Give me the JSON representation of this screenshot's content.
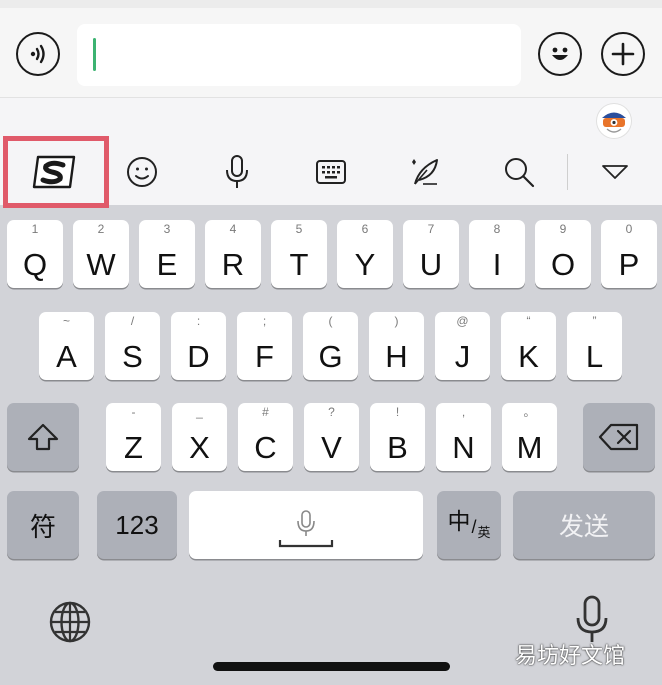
{
  "chat": {
    "voice_icon": "voice-wave-icon",
    "emoji_icon": "smiley-icon",
    "add_icon": "plus-icon",
    "input_value": ""
  },
  "ime_toolbar": {
    "items": [
      "sogou-logo-icon",
      "emoji-face-icon",
      "microphone-icon",
      "keyboard-icon",
      "quill-icon",
      "search-icon",
      "collapse-triangle-icon"
    ],
    "highlight_color": "#e05a6a"
  },
  "keyboard": {
    "row1": [
      {
        "letter": "Q",
        "hint": "1"
      },
      {
        "letter": "W",
        "hint": "2"
      },
      {
        "letter": "E",
        "hint": "3"
      },
      {
        "letter": "R",
        "hint": "4"
      },
      {
        "letter": "T",
        "hint": "5"
      },
      {
        "letter": "Y",
        "hint": "6"
      },
      {
        "letter": "U",
        "hint": "7"
      },
      {
        "letter": "I",
        "hint": "8"
      },
      {
        "letter": "O",
        "hint": "9"
      },
      {
        "letter": "P",
        "hint": "0"
      }
    ],
    "row2": [
      {
        "letter": "A",
        "hint": "~"
      },
      {
        "letter": "S",
        "hint": "/"
      },
      {
        "letter": "D",
        "hint": ":"
      },
      {
        "letter": "F",
        "hint": ";"
      },
      {
        "letter": "G",
        "hint": "("
      },
      {
        "letter": "H",
        "hint": ")"
      },
      {
        "letter": "J",
        "hint": "@"
      },
      {
        "letter": "K",
        "hint": "“"
      },
      {
        "letter": "L",
        "hint": "”"
      }
    ],
    "row3": [
      {
        "letter": "Z",
        "hint": "-"
      },
      {
        "letter": "X",
        "hint": "_"
      },
      {
        "letter": "C",
        "hint": "#"
      },
      {
        "letter": "V",
        "hint": "?"
      },
      {
        "letter": "B",
        "hint": "!"
      },
      {
        "letter": "N",
        "hint": ","
      },
      {
        "letter": "M",
        "hint": "。"
      }
    ],
    "symbol_label": "符",
    "numbers_label": "123",
    "lang_main": "中",
    "lang_sub": "英",
    "send_label": "发送"
  },
  "watermark": "易坊好文馆"
}
